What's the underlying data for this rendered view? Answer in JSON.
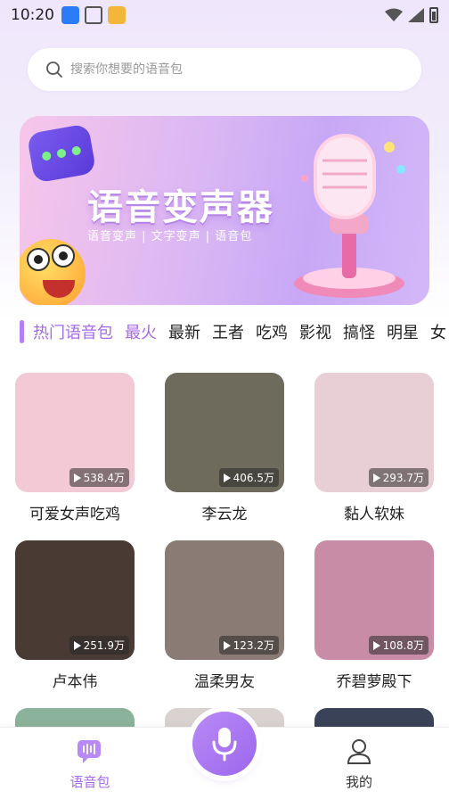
{
  "status_bar": {
    "time": "10:20"
  },
  "search": {
    "placeholder": "搜索你想要的语音包"
  },
  "banner": {
    "title": "语音变声器",
    "subtitle": "语音变声 | 文字变声 | 语音包"
  },
  "categories": [
    {
      "label": "热门语音包",
      "active": true
    },
    {
      "label": "最火",
      "active": true
    },
    {
      "label": "最新",
      "active": false
    },
    {
      "label": "王者",
      "active": false
    },
    {
      "label": "吃鸡",
      "active": false
    },
    {
      "label": "影视",
      "active": false
    },
    {
      "label": "搞怪",
      "active": false
    },
    {
      "label": "明星",
      "active": false
    },
    {
      "label": "女",
      "active": false
    }
  ],
  "packs": [
    {
      "name": "可爱女声吃鸡",
      "plays": "538.4万",
      "color": "#f3c9d6"
    },
    {
      "name": "李云龙",
      "plays": "406.5万",
      "color": "#6e6a5c"
    },
    {
      "name": "黏人软妹",
      "plays": "293.7万",
      "color": "#e8cfd6"
    },
    {
      "name": "卢本伟",
      "plays": "251.9万",
      "color": "#4a3a34"
    },
    {
      "name": "温柔男友",
      "plays": "123.2万",
      "color": "#8a7b74"
    },
    {
      "name": "乔碧萝殿下",
      "plays": "108.8万",
      "color": "#c98ca6"
    }
  ],
  "bottom_nav": {
    "voice_pack": "语音包",
    "me": "我的"
  },
  "colors": {
    "accent": "#a66ae8"
  }
}
